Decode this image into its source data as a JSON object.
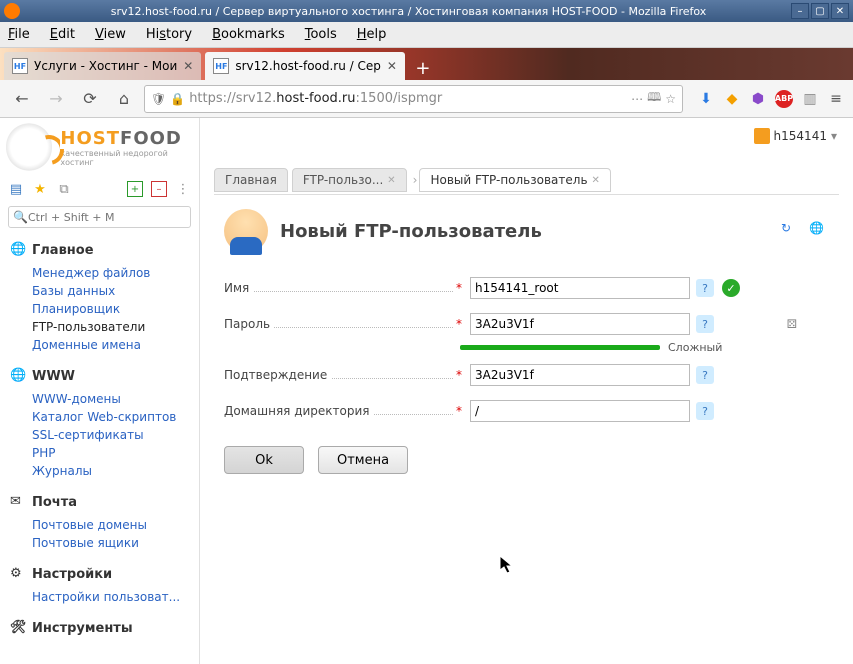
{
  "window": {
    "title": "srv12.host-food.ru / Сервер виртуального хостинга / Хостинговая компания HOST-FOOD - Mozilla Firefox"
  },
  "menubar": [
    "File",
    "Edit",
    "View",
    "History",
    "Bookmarks",
    "Tools",
    "Help"
  ],
  "tabs": [
    {
      "label": "Услуги - Хостинг - Мои",
      "active": false
    },
    {
      "label": "srv12.host-food.ru / Сер",
      "active": true
    }
  ],
  "url": {
    "scheme": "https://",
    "sub": "srv12.",
    "domain": "host-food.ru",
    "port": ":1500",
    "path": "/ispmgr"
  },
  "logo": {
    "brand_a": "HOST",
    "brand_b": "FOOD",
    "tag": "качественный недорогой хостинг"
  },
  "search_placeholder": "Ctrl + Shift + M",
  "user": "h154141",
  "sidebar": [
    {
      "title": "Главное",
      "icon": "globe",
      "items": [
        "Менеджер файлов",
        "Базы данных",
        "Планировщик",
        "FTP-пользователи",
        "Доменные имена"
      ],
      "active_index": 3
    },
    {
      "title": "WWW",
      "icon": "globe",
      "items": [
        "WWW-домены",
        "Каталог Web-скриптов",
        "SSL-сертификаты",
        "PHP",
        "Журналы"
      ]
    },
    {
      "title": "Почта",
      "icon": "mail",
      "items": [
        "Почтовые домены",
        "Почтовые ящики"
      ]
    },
    {
      "title": "Настройки",
      "icon": "gear",
      "items": [
        "Настройки пользоват..."
      ]
    },
    {
      "title": "Инструменты",
      "icon": "tool",
      "items": []
    }
  ],
  "breadcrumb": [
    {
      "label": "Главная",
      "closable": false
    },
    {
      "label": "FTP-пользо...",
      "closable": true
    },
    {
      "label": "Новый FTP-пользователь",
      "closable": true,
      "active": true
    }
  ],
  "form": {
    "title": "Новый FTP-пользователь",
    "fields": {
      "name": {
        "label": "Имя",
        "value": "h154141_root"
      },
      "password": {
        "label": "Пароль",
        "value": "3A2u3V1f",
        "strength": "Сложный"
      },
      "confirm": {
        "label": "Подтверждение",
        "value": "3A2u3V1f"
      },
      "homedir": {
        "label": "Домашняя директория",
        "value": "/"
      }
    },
    "buttons": {
      "ok": "Ok",
      "cancel": "Отмена"
    }
  }
}
